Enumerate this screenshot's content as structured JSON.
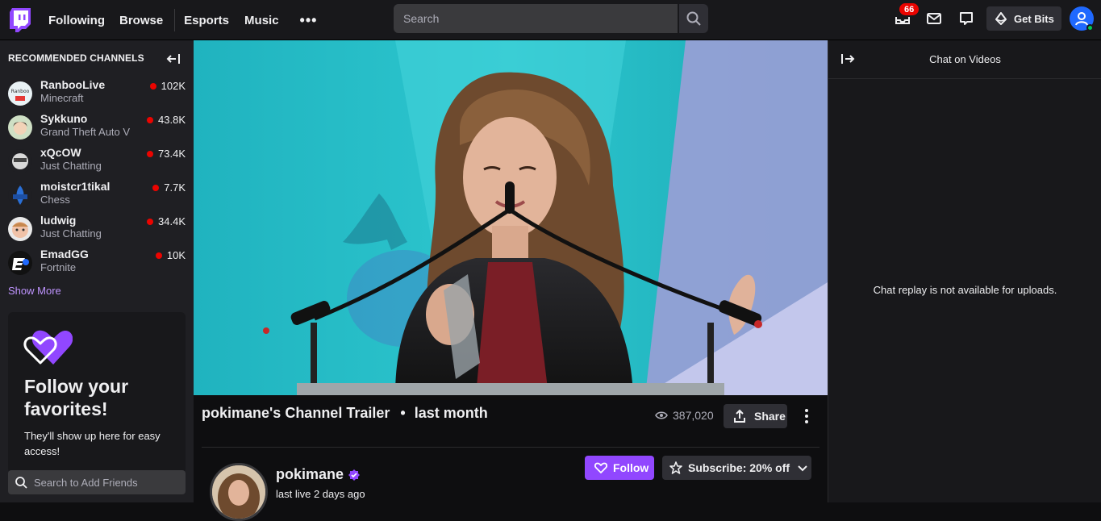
{
  "nav": {
    "links": [
      "Following",
      "Browse",
      "Esports",
      "Music"
    ],
    "more": "•••",
    "search_placeholder": "Search",
    "notifications_count": "66",
    "get_bits": "Get Bits"
  },
  "sidebar": {
    "title": "RECOMMENDED CHANNELS",
    "channels": [
      {
        "name": "RanbooLive",
        "game": "Minecraft",
        "viewers": "102K"
      },
      {
        "name": "Sykkuno",
        "game": "Grand Theft Auto V",
        "viewers": "43.8K"
      },
      {
        "name": "xQcOW",
        "game": "Just Chatting",
        "viewers": "73.4K"
      },
      {
        "name": "moistcr1tikal",
        "game": "Chess",
        "viewers": "7.7K"
      },
      {
        "name": "ludwig",
        "game": "Just Chatting",
        "viewers": "34.4K"
      },
      {
        "name": "EmadGG",
        "game": "Fortnite",
        "viewers": "10K"
      }
    ],
    "show_more": "Show More",
    "promo": {
      "title_line1": "Follow your",
      "title_line2": "favorites!",
      "body": "They'll show up here for easy access!"
    },
    "friends_placeholder": "Search to Add Friends"
  },
  "video": {
    "title": "pokimane's Channel Trailer",
    "separator": "•",
    "age": "last month",
    "views": "387,020",
    "share": "Share"
  },
  "channel": {
    "name": "pokimane",
    "status": "last live 2 days ago",
    "follow": "Follow",
    "subscribe": "Subscribe: 20% off"
  },
  "chat": {
    "header": "Chat on Videos",
    "message": "Chat replay is not available for uploads."
  },
  "colors": {
    "accent": "#9147ff",
    "live_red": "#eb0400",
    "link": "#bf94ff"
  }
}
